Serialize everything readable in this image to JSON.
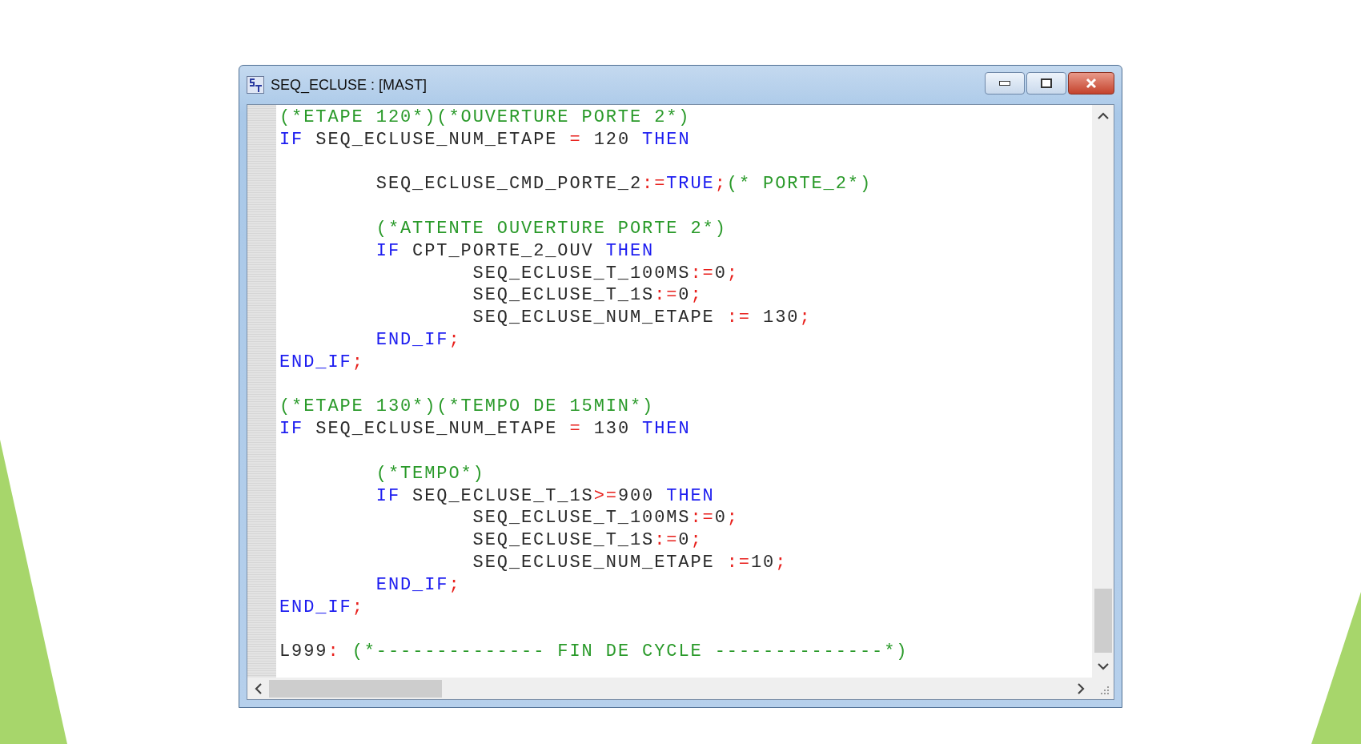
{
  "window": {
    "title": "SEQ_ECLUSE : [MAST]"
  },
  "lines": [
    {
      "kind": "code",
      "tokens": [
        {
          "kind": "comment",
          "text": "(*ETAPE 120*)(*OUVERTURE PORTE 2*)"
        }
      ]
    },
    {
      "kind": "code",
      "tokens": [
        {
          "kind": "keyword",
          "text": "IF"
        },
        {
          "kind": "ident",
          "text": " SEQ_ECLUSE_NUM_ETAPE "
        },
        {
          "kind": "op",
          "text": "="
        },
        {
          "kind": "number",
          "text": " 120 "
        },
        {
          "kind": "keyword",
          "text": "THEN"
        }
      ]
    },
    {
      "kind": "blank"
    },
    {
      "kind": "code",
      "tokens": [
        {
          "kind": "tab"
        },
        {
          "kind": "ident",
          "text": "SEQ_ECLUSE_CMD_PORTE_2"
        },
        {
          "kind": "op",
          "text": ":="
        },
        {
          "kind": "keyword",
          "text": "TRUE"
        },
        {
          "kind": "op",
          "text": ";"
        },
        {
          "kind": "comment",
          "text": "(* PORTE_2*)"
        }
      ]
    },
    {
      "kind": "blank"
    },
    {
      "kind": "code",
      "tokens": [
        {
          "kind": "tab"
        },
        {
          "kind": "comment",
          "text": "(*ATTENTE OUVERTURE PORTE 2*)"
        }
      ]
    },
    {
      "kind": "code",
      "tokens": [
        {
          "kind": "tab"
        },
        {
          "kind": "keyword",
          "text": "IF"
        },
        {
          "kind": "ident",
          "text": " CPT_PORTE_2_OUV "
        },
        {
          "kind": "keyword",
          "text": "THEN"
        }
      ]
    },
    {
      "kind": "code",
      "tokens": [
        {
          "kind": "tab"
        },
        {
          "kind": "tab"
        },
        {
          "kind": "ident",
          "text": "SEQ_ECLUSE_T_100MS"
        },
        {
          "kind": "op",
          "text": ":="
        },
        {
          "kind": "number",
          "text": "0"
        },
        {
          "kind": "op",
          "text": ";"
        }
      ]
    },
    {
      "kind": "code",
      "tokens": [
        {
          "kind": "tab"
        },
        {
          "kind": "tab"
        },
        {
          "kind": "ident",
          "text": "SEQ_ECLUSE_T_1S"
        },
        {
          "kind": "op",
          "text": ":="
        },
        {
          "kind": "number",
          "text": "0"
        },
        {
          "kind": "op",
          "text": ";"
        }
      ]
    },
    {
      "kind": "code",
      "tokens": [
        {
          "kind": "tab"
        },
        {
          "kind": "tab"
        },
        {
          "kind": "ident",
          "text": "SEQ_ECLUSE_NUM_ETAPE "
        },
        {
          "kind": "op",
          "text": ":="
        },
        {
          "kind": "number",
          "text": " 130"
        },
        {
          "kind": "op",
          "text": ";"
        }
      ]
    },
    {
      "kind": "code",
      "tokens": [
        {
          "kind": "tab"
        },
        {
          "kind": "keyword",
          "text": "END_IF"
        },
        {
          "kind": "op",
          "text": ";"
        }
      ]
    },
    {
      "kind": "code",
      "tokens": [
        {
          "kind": "keyword",
          "text": "END_IF"
        },
        {
          "kind": "op",
          "text": ";"
        }
      ]
    },
    {
      "kind": "blank"
    },
    {
      "kind": "code",
      "tokens": [
        {
          "kind": "comment",
          "text": "(*ETAPE 130*)(*TEMPO DE 15MIN*)"
        }
      ]
    },
    {
      "kind": "code",
      "tokens": [
        {
          "kind": "keyword",
          "text": "IF"
        },
        {
          "kind": "ident",
          "text": " SEQ_ECLUSE_NUM_ETAPE "
        },
        {
          "kind": "op",
          "text": "="
        },
        {
          "kind": "number",
          "text": " 130 "
        },
        {
          "kind": "keyword",
          "text": "THEN"
        }
      ]
    },
    {
      "kind": "blank"
    },
    {
      "kind": "code",
      "tokens": [
        {
          "kind": "tab"
        },
        {
          "kind": "comment",
          "text": "(*TEMPO*)"
        }
      ]
    },
    {
      "kind": "code",
      "tokens": [
        {
          "kind": "tab"
        },
        {
          "kind": "keyword",
          "text": "IF"
        },
        {
          "kind": "ident",
          "text": " SEQ_ECLUSE_T_1S"
        },
        {
          "kind": "op",
          "text": ">="
        },
        {
          "kind": "number",
          "text": "900 "
        },
        {
          "kind": "keyword",
          "text": "THEN"
        }
      ]
    },
    {
      "kind": "code",
      "tokens": [
        {
          "kind": "tab"
        },
        {
          "kind": "tab"
        },
        {
          "kind": "ident",
          "text": "SEQ_ECLUSE_T_100MS"
        },
        {
          "kind": "op",
          "text": ":="
        },
        {
          "kind": "number",
          "text": "0"
        },
        {
          "kind": "op",
          "text": ";"
        }
      ]
    },
    {
      "kind": "code",
      "tokens": [
        {
          "kind": "tab"
        },
        {
          "kind": "tab"
        },
        {
          "kind": "ident",
          "text": "SEQ_ECLUSE_T_1S"
        },
        {
          "kind": "op",
          "text": ":="
        },
        {
          "kind": "number",
          "text": "0"
        },
        {
          "kind": "op",
          "text": ";"
        }
      ]
    },
    {
      "kind": "code",
      "tokens": [
        {
          "kind": "tab"
        },
        {
          "kind": "tab"
        },
        {
          "kind": "ident",
          "text": "SEQ_ECLUSE_NUM_ETAPE "
        },
        {
          "kind": "op",
          "text": ":="
        },
        {
          "kind": "number",
          "text": "10"
        },
        {
          "kind": "op",
          "text": ";"
        }
      ]
    },
    {
      "kind": "code",
      "tokens": [
        {
          "kind": "tab"
        },
        {
          "kind": "keyword",
          "text": "END_IF"
        },
        {
          "kind": "op",
          "text": ";"
        }
      ]
    },
    {
      "kind": "code",
      "tokens": [
        {
          "kind": "keyword",
          "text": "END_IF"
        },
        {
          "kind": "op",
          "text": ";"
        }
      ]
    },
    {
      "kind": "blank"
    },
    {
      "kind": "code",
      "tokens": [
        {
          "kind": "ident",
          "text": "L999"
        },
        {
          "kind": "op",
          "text": ":"
        },
        {
          "kind": "comment",
          "text": " (*-------------- FIN DE CYCLE --------------*)"
        }
      ]
    }
  ]
}
